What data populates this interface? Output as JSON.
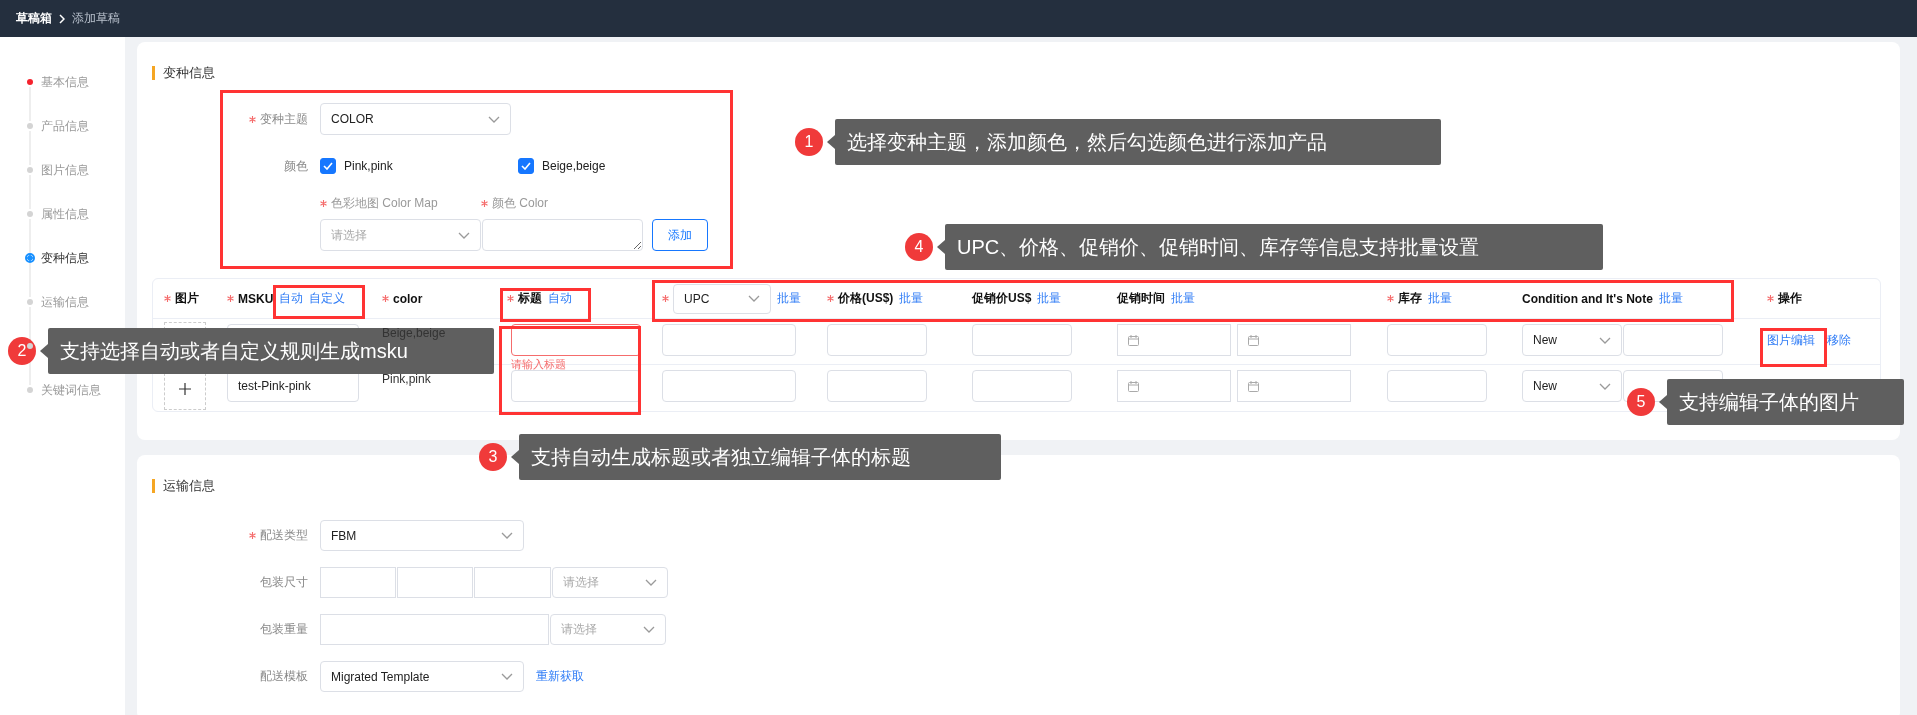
{
  "breadcrumb": [
    {
      "label": "草稿箱"
    },
    {
      "label": "添加草稿"
    }
  ],
  "sidebar": {
    "items": [
      {
        "label": "基本信息",
        "error": true,
        "selected": false
      },
      {
        "label": "产品信息",
        "error": false,
        "selected": false
      },
      {
        "label": "图片信息",
        "error": false,
        "selected": false
      },
      {
        "label": "属性信息",
        "error": false,
        "selected": false
      },
      {
        "label": "变种信息",
        "error": false,
        "selected": true
      },
      {
        "label": "运输信息",
        "error": false,
        "selected": false
      },
      {
        "error": false,
        "selected": false
      },
      {
        "label": "关键词信息",
        "error": false,
        "selected": false
      }
    ]
  },
  "variant_section": {
    "title": "变种信息",
    "theme": {
      "label": "变种主题",
      "required": true,
      "value": "COLOR"
    },
    "colors": {
      "label": "颜色",
      "options": [
        {
          "label": "Pink,pink",
          "checked": true
        },
        {
          "label": "Beige,beige",
          "checked": true
        }
      ]
    },
    "color_map": {
      "label": "色彩地图 Color Map",
      "required": true,
      "placeholder": "请选择"
    },
    "color_input": {
      "label": "颜色 Color",
      "required": true
    },
    "add_button": "添加"
  },
  "table": {
    "columns": [
      {
        "kind": "text",
        "label": "图片",
        "required": true
      },
      {
        "kind": "text",
        "label": "MSKU",
        "required": true,
        "links": [
          "自动",
          "自定义"
        ]
      },
      {
        "kind": "text",
        "label": "color",
        "required": true
      },
      {
        "kind": "text",
        "label": "标题",
        "required": true,
        "links": [
          "自动"
        ]
      },
      {
        "kind": "select",
        "value": "UPC",
        "required": true,
        "links": [
          "批量"
        ]
      },
      {
        "kind": "text",
        "label": "价格(US$)",
        "required": true,
        "links": [
          "批量"
        ]
      },
      {
        "kind": "text",
        "label": "促销价US$",
        "required": false,
        "links": [
          "批量"
        ]
      },
      {
        "kind": "text",
        "label": "促销时间",
        "required": false,
        "links": [
          "批量"
        ]
      },
      {
        "kind": "text",
        "label": "库存",
        "required": true,
        "links": [
          "批量"
        ]
      },
      {
        "kind": "text",
        "label": "Condition and It's Note",
        "required": false,
        "links": [
          "批量"
        ]
      },
      {
        "kind": "text",
        "label": "操作",
        "required": true
      }
    ],
    "rows": [
      {
        "variant": "Beige,beige",
        "title_error": "请输入标题",
        "condition": "New",
        "actions": [
          "图片编辑",
          "移除"
        ]
      },
      {
        "msku": "test-Pink-pink",
        "variant": "Pink,pink",
        "condition": "New"
      }
    ]
  },
  "shipping_section": {
    "title": "运输信息",
    "fields": [
      {
        "kind": "select",
        "label": "配送类型",
        "required": true,
        "value": "FBM"
      },
      {
        "kind": "dimensions",
        "label": "包装尺寸",
        "required": false,
        "unit_placeholder": "请选择"
      },
      {
        "kind": "weight",
        "label": "包装重量",
        "required": false,
        "unit_placeholder": "请选择"
      },
      {
        "kind": "select",
        "label": "配送模板",
        "required": false,
        "value": "Migrated Template",
        "link": "重新获取"
      }
    ]
  },
  "annotations": [
    {
      "number": "1",
      "text": "选择变种主题，添加颜色，然后勾选颜色进行添加产品"
    },
    {
      "number": "2",
      "text": "支持选择自动或者自定义规则生成msku"
    },
    {
      "number": "3",
      "text": "支持自动生成标题或者独立编辑子体的标题"
    },
    {
      "number": "4",
      "text": "UPC、价格、促销价、促销时间、库存等信息支持批量设置"
    },
    {
      "number": "5",
      "text": "支持编辑子体的图片"
    }
  ]
}
